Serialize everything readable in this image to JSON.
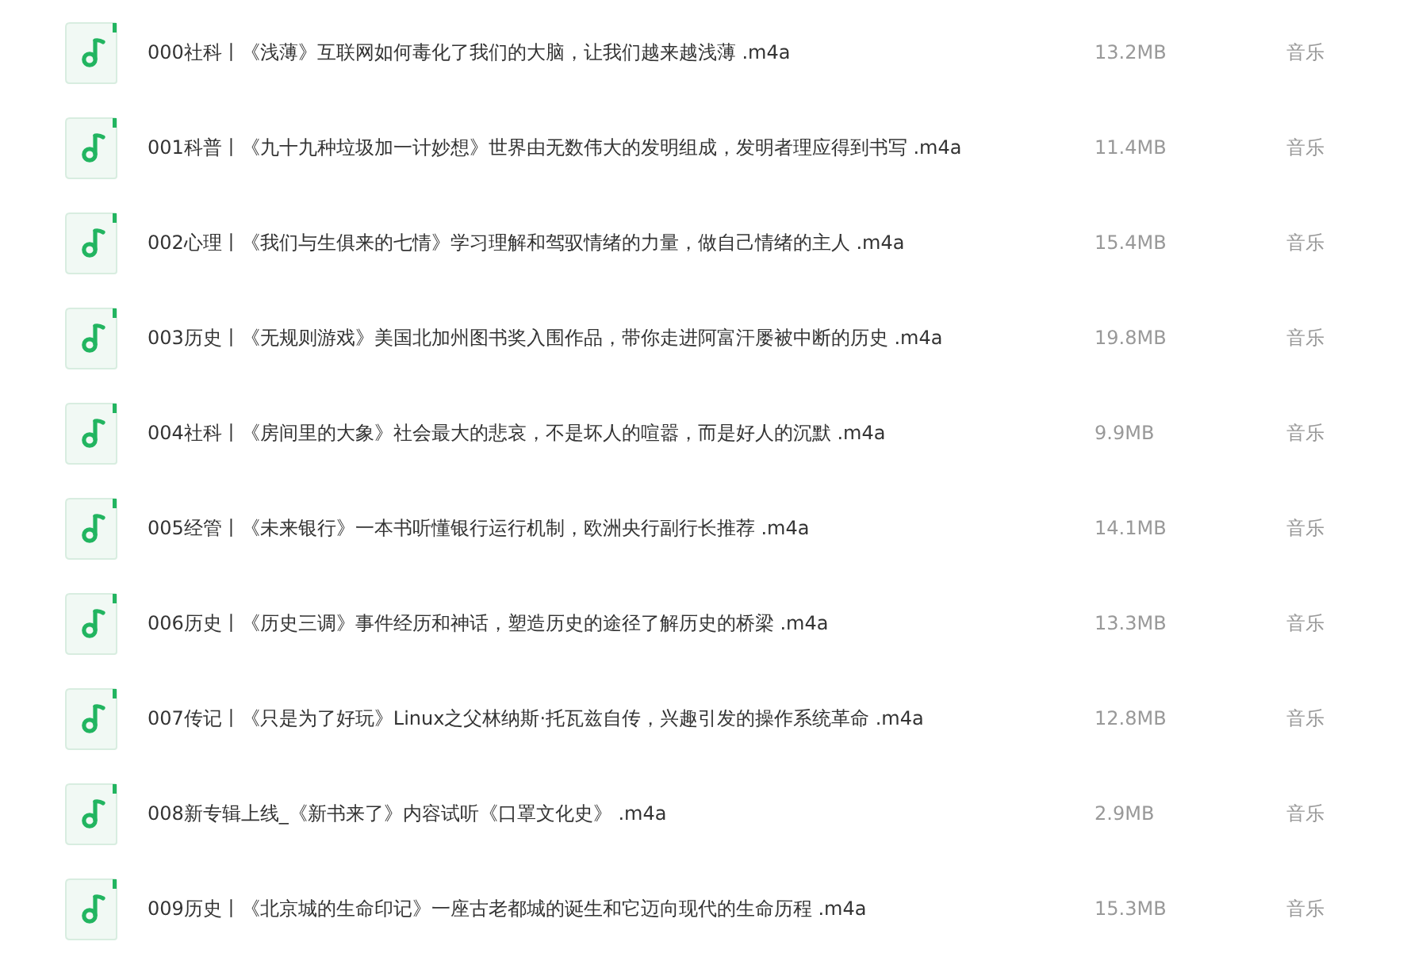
{
  "files": [
    {
      "name": "000社科丨《浅薄》互联网如何毒化了我们的大脑，让我们越来越浅薄 .m4a",
      "size": "13.2MB",
      "type": "音乐"
    },
    {
      "name": "001科普丨《九十九种垃圾加一计妙想》世界由无数伟大的发明组成，发明者理应得到书写 .m4a",
      "size": "11.4MB",
      "type": "音乐"
    },
    {
      "name": "002心理丨《我们与生俱来的七情》学习理解和驾驭情绪的力量，做自己情绪的主人 .m4a",
      "size": "15.4MB",
      "type": "音乐"
    },
    {
      "name": "003历史丨《无规则游戏》美国北加州图书奖入围作品，带你走进阿富汗屡被中断的历史 .m4a",
      "size": "19.8MB",
      "type": "音乐"
    },
    {
      "name": "004社科丨《房间里的大象》社会最大的悲哀，不是坏人的喧嚣，而是好人的沉默 .m4a",
      "size": "9.9MB",
      "type": "音乐"
    },
    {
      "name": "005经管丨《未来银行》一本书听懂银行运行机制，欧洲央行副行长推荐 .m4a",
      "size": "14.1MB",
      "type": "音乐"
    },
    {
      "name": "006历史丨《历史三调》事件经历和神话，塑造历史的途径了解历史的桥梁 .m4a",
      "size": "13.3MB",
      "type": "音乐"
    },
    {
      "name": "007传记丨《只是为了好玩》Linux之父林纳斯·托瓦兹自传，兴趣引发的操作系统革命 .m4a",
      "size": "12.8MB",
      "type": "音乐"
    },
    {
      "name": "008新专辑上线_《新书来了》内容试听《口罩文化史》 .m4a",
      "size": "2.9MB",
      "type": "音乐"
    },
    {
      "name": "009历史丨《北京城的生命印记》一座古老都城的诞生和它迈向现代的生命历程 .m4a",
      "size": "15.3MB",
      "type": "音乐"
    }
  ]
}
